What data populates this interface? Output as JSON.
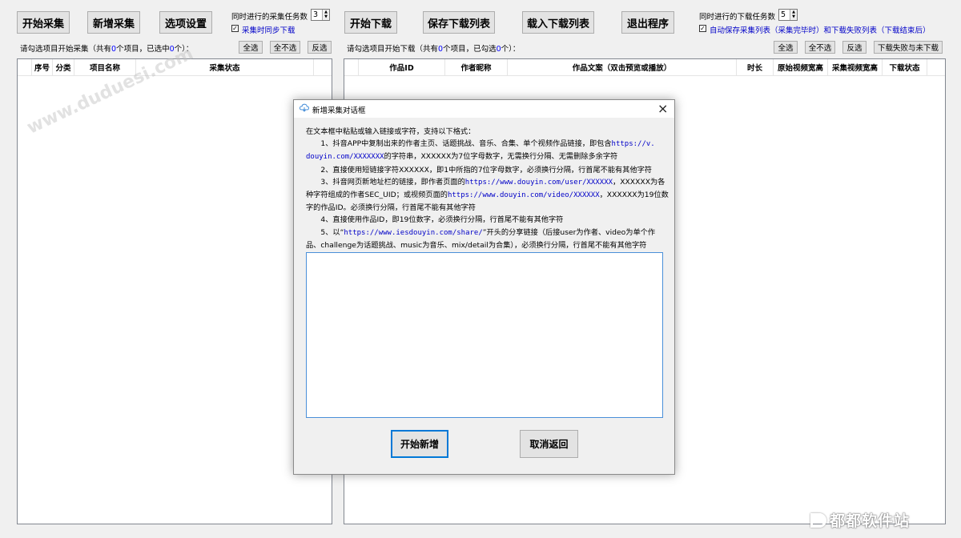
{
  "toolbar": {
    "start_collect": "开始采集",
    "add_collect": "新增采集",
    "options": "选项设置",
    "collect_tasks_label": "同时进行的采集任务数",
    "collect_tasks_value": "3",
    "sync_download_label": "采集时同步下载",
    "sync_download_checked": "✓",
    "start_download": "开始下载",
    "save_list": "保存下载列表",
    "load_list": "载入下载列表",
    "exit": "退出程序",
    "download_tasks_label": "同时进行的下载任务数",
    "download_tasks_value": "5",
    "autosave_label": "自动保存采集列表（采集完毕时）和下载失败列表（下载结束后）",
    "autosave_checked": "✓"
  },
  "left": {
    "hint_pre": "请勾选项目开始采集（共有",
    "count_total": "0",
    "hint_mid": "个项目，已选中",
    "count_selected": "0",
    "hint_post": "个）：",
    "select_all": "全选",
    "select_none": "全不选",
    "invert": "反选",
    "columns": [
      "序号",
      "分类",
      "项目名称",
      "采集状态"
    ]
  },
  "right": {
    "hint_pre": "请勾选项目开始下载（共有",
    "count_total": "0",
    "hint_mid": "个项目，已勾选",
    "count_selected": "0",
    "hint_post": "个）：",
    "select_all": "全选",
    "select_none": "全不选",
    "invert": "反选",
    "failed_btn": "下载失败与未下载",
    "columns": [
      "作品ID",
      "作者昵称",
      "作品文案（双击预览或播放）",
      "时长",
      "原始视频宽高",
      "采集视频宽高",
      "下载状态"
    ]
  },
  "watermark": "www.duduesi.com",
  "brand_mark": "都都软件站",
  "dialog": {
    "title": "新增采集对话框",
    "close": "×",
    "intro": "在文本框中粘贴或输入链接或字符，支持以下格式：",
    "l1a": "　　1、抖音APP中复制出来的作者主页、话题挑战、音乐、合集、单个视频作品链接，即包含",
    "l1b": "https://v.",
    "l2a": "douyin.com/XXXXXXX",
    "l2b": "的字符串，XXXXXX为7位字母数字，无需换行分隔、无需删除多余字符",
    "l3": "　　2、直接使用短链接字符XXXXXX，即1中所指的7位字母数字，必须换行分隔，行首尾不能有其他字符",
    "l4a": "　　3、抖音网页新地址栏的链接，即作者页面的",
    "l4b": "https://www.douyin.com/user/XXXXXX",
    "l4c": "，XXXXXX为各",
    "l5a": "种字符组成的作者SEC_UID；或视频页面的",
    "l5b": "https://www.douyin.com/video/XXXXXX",
    "l5c": "，XXXXXX为19位数",
    "l6": "字的作品ID。必须换行分隔，行首尾不能有其他字符",
    "l7": "　　4、直接使用作品ID，即19位数字，必须换行分隔，行首尾不能有其他字符",
    "l8a": "　　5、以“",
    "l8b": "https://www.iesdouyin.com/share/",
    "l8c": "”开头的分享链接（后接user为作者、video为单个作",
    "l9": "品、challenge为话题挑战、music为音乐、mix/detail为合集），必须换行分隔，行首尾不能有其他字符",
    "textarea_value": "",
    "confirm": "开始新增",
    "cancel": "取消返回"
  }
}
